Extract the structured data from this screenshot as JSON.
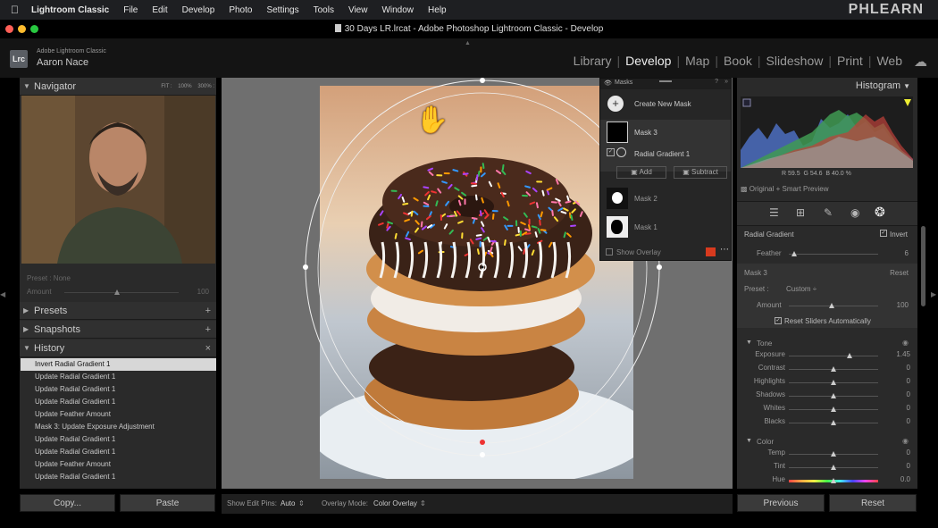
{
  "menubar": {
    "app": "Lightroom Classic",
    "items": [
      "File",
      "Edit",
      "Develop",
      "Photo",
      "Settings",
      "Tools",
      "View",
      "Window",
      "Help"
    ],
    "watermark": "PHLEARN"
  },
  "titlebar": {
    "title": "30 Days LR.lrcat - Adobe Photoshop Lightroom Classic - Develop"
  },
  "identity": {
    "line1": "Adobe Lightroom Classic",
    "line2": "Aaron Nace",
    "badge": "Lrc"
  },
  "modules": {
    "items": [
      "Library",
      "Develop",
      "Map",
      "Book",
      "Slideshow",
      "Print",
      "Web"
    ],
    "active": "Develop"
  },
  "left": {
    "navigator": {
      "title": "Navigator",
      "zoom": [
        "FIT :",
        "100%",
        "300% :"
      ]
    },
    "preset_info": {
      "preset": "Preset : None",
      "amount_label": "Amount",
      "amount_value": "100"
    },
    "panels": {
      "presets": "Presets",
      "snapshots": "Snapshots",
      "history": "History"
    },
    "history": [
      "Invert Radial Gradient 1",
      "Update Radial Gradient 1",
      "Update Radial Gradient 1",
      "Update Radial Gradient 1",
      "Update Feather Amount",
      "Mask 3: Update Exposure Adjustment",
      "Update Radial Gradient 1",
      "Update Radial Gradient 1",
      "Update Feather Amount",
      "Update Radial Gradient 1"
    ],
    "copy": "Copy...",
    "paste": "Paste"
  },
  "toolbar": {
    "show_pins_label": "Show Edit Pins:",
    "show_pins_value": "Auto",
    "overlay_label": "Overlay Mode:",
    "overlay_value": "Color Overlay"
  },
  "masks": {
    "title": "Masks",
    "create": "Create New Mask",
    "mask3": "Mask 3",
    "radial": "Radial Gradient 1",
    "add": "Add",
    "subtract": "Subtract",
    "mask2": "Mask 2",
    "mask1": "Mask 1",
    "show_overlay": "Show Overlay",
    "overlay_color": "#d83a1e"
  },
  "right": {
    "histogram": {
      "title": "Histogram",
      "r": "R 59.5",
      "g": "G 54.6",
      "b": "B 40.0 %"
    },
    "smart_preview": "Original + Smart Preview",
    "radial": {
      "title": "Radial Gradient",
      "invert": "Invert",
      "feather_label": "Feather",
      "feather_value": "6"
    },
    "mask": {
      "title": "Mask 3",
      "reset": "Reset",
      "preset_label": "Preset :",
      "preset_value": "Custom ÷",
      "amount_label": "Amount",
      "amount_value": "100",
      "reset_sliders": "Reset Sliders Automatically"
    },
    "tone": {
      "title": "Tone",
      "rows": [
        {
          "label": "Exposure",
          "value": "1.45",
          "pos": 0.68
        },
        {
          "label": "Contrast",
          "value": "0",
          "pos": 0.5
        },
        {
          "label": "Highlights",
          "value": "0",
          "pos": 0.5
        },
        {
          "label": "Shadows",
          "value": "0",
          "pos": 0.5
        },
        {
          "label": "Whites",
          "value": "0",
          "pos": 0.5
        },
        {
          "label": "Blacks",
          "value": "0",
          "pos": 0.5
        }
      ]
    },
    "color": {
      "title": "Color",
      "rows": [
        {
          "label": "Temp",
          "value": "0",
          "pos": 0.5
        },
        {
          "label": "Tint",
          "value": "0",
          "pos": 0.5
        },
        {
          "label": "Hue",
          "value": "0.0",
          "pos": 0.5
        }
      ]
    },
    "previous": "Previous",
    "reset": "Reset"
  }
}
